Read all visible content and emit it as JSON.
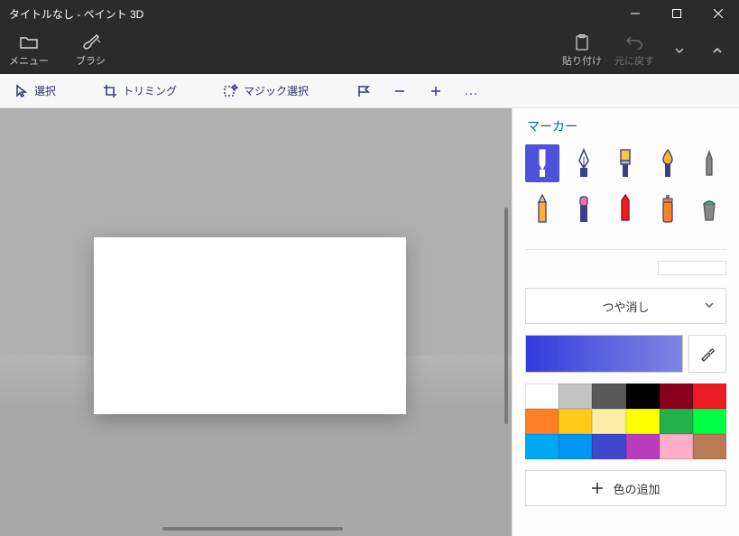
{
  "window": {
    "title": "タイトルなし - ペイント 3D"
  },
  "ribbon": {
    "menu": "メニュー",
    "brushes": "ブラシ",
    "paste": "貼り付け",
    "undo": "元に戻す"
  },
  "toolbar": {
    "select": "選択",
    "crop": "トリミング",
    "magic_select": "マジック選択",
    "more": "…"
  },
  "panel": {
    "title": "マーカー",
    "finish_label": "つや消し",
    "add_color": "色の追加",
    "current_color": "#4d52d8",
    "brushes": [
      {
        "id": "marker",
        "selected": true
      },
      {
        "id": "calligraphy-pen",
        "selected": false
      },
      {
        "id": "oil-brush",
        "selected": false
      },
      {
        "id": "watercolor",
        "selected": false
      },
      {
        "id": "pixel-pen",
        "selected": false
      },
      {
        "id": "pencil",
        "selected": false
      },
      {
        "id": "eraser",
        "selected": false
      },
      {
        "id": "crayon",
        "selected": false
      },
      {
        "id": "spray-can",
        "selected": false
      },
      {
        "id": "fill",
        "selected": false
      }
    ],
    "swatches": [
      "#ffffff",
      "#c3c3c3",
      "#585858",
      "#000000",
      "#88001b",
      "#ec1c24",
      "#ff7f27",
      "#ffca18",
      "#fdeca6",
      "#ffff00",
      "#22b14c",
      "#00ff44",
      "#00a8f3",
      "#0096f3",
      "#3f48cc",
      "#b83dba",
      "#ffaec8",
      "#b97a56"
    ]
  }
}
